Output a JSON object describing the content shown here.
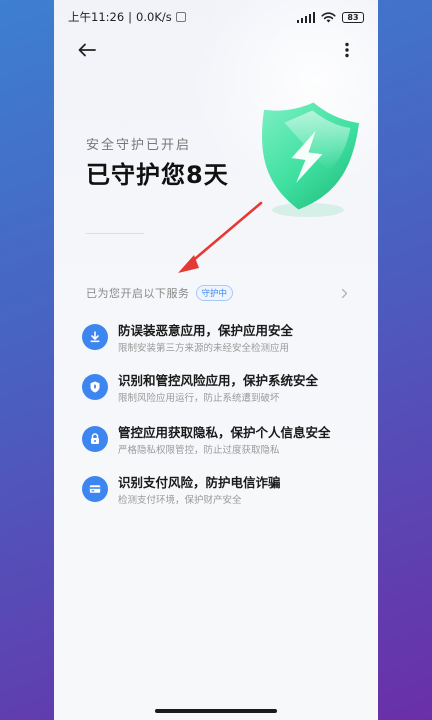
{
  "status_bar": {
    "time": "上午11:26",
    "network_speed": "0.0K/s",
    "battery": "83"
  },
  "header": {
    "back_icon": "back-arrow-icon",
    "more_icon": "more-vertical-icon"
  },
  "hero": {
    "subtitle": "安全守护已开启",
    "title": "已守护您8天",
    "shield_icon": "shield-lightning-icon",
    "colors": {
      "shield": "#3fe0a0",
      "shield_dark": "#1fba7a",
      "arrow": "#e53935"
    }
  },
  "services": {
    "label": "已为您开启以下服务",
    "badge": "守护中",
    "features": [
      {
        "icon": "download-icon",
        "title": "防误装恶意应用，保护应用安全",
        "desc": "限制安装第三方来源的未经安全检测应用"
      },
      {
        "icon": "shield-icon",
        "title": "识别和管控风险应用，保护系统安全",
        "desc": "限制风险应用运行，防止系统遭到破坏"
      },
      {
        "icon": "lock-icon",
        "title": "管控应用获取隐私，保护个人信息安全",
        "desc": "严格隐私权限管控，防止过度获取隐私"
      },
      {
        "icon": "card-icon",
        "title": "识别支付风险，防护电信诈骗",
        "desc": "检测支付环境，保护财产安全"
      }
    ]
  },
  "accent_color": "#3d86f0"
}
